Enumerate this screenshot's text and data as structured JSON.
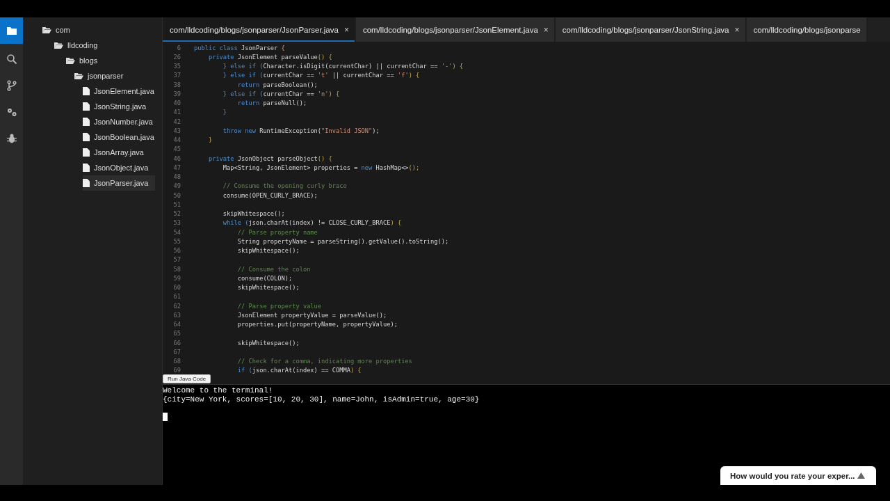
{
  "activity_bar": [
    {
      "kind": "files",
      "selected": true
    },
    {
      "kind": "search",
      "selected": false
    },
    {
      "kind": "branch",
      "selected": false
    },
    {
      "kind": "gears",
      "selected": false
    },
    {
      "kind": "bug",
      "selected": false
    }
  ],
  "tree": [
    {
      "label": "com",
      "kind": "folder",
      "children": [
        {
          "label": "lldcoding",
          "kind": "folder",
          "children": [
            {
              "label": "blogs",
              "kind": "folder",
              "children": [
                {
                  "label": "jsonparser",
                  "kind": "folder",
                  "children": [
                    {
                      "label": "JsonElement.java",
                      "kind": "file",
                      "selected": false
                    },
                    {
                      "label": "JsonString.java",
                      "kind": "file",
                      "selected": false
                    },
                    {
                      "label": "JsonNumber.java",
                      "kind": "file",
                      "selected": false
                    },
                    {
                      "label": "JsonBoolean.java",
                      "kind": "file",
                      "selected": false
                    },
                    {
                      "label": "JsonArray.java",
                      "kind": "file",
                      "selected": false
                    },
                    {
                      "label": "JsonObject.java",
                      "kind": "file",
                      "selected": false
                    },
                    {
                      "label": "JsonParser.java",
                      "kind": "file",
                      "selected": true
                    }
                  ]
                }
              ]
            }
          ]
        }
      ]
    }
  ],
  "tabs": [
    {
      "label": "com/lldcoding/blogs/jsonparser/JsonParser.java",
      "close": "×",
      "selected": true
    },
    {
      "label": "com/lldcoding/blogs/jsonparser/JsonElement.java",
      "close": "×",
      "selected": false
    },
    {
      "label": "com/lldcoding/blogs/jsonparser/JsonString.java",
      "close": "×",
      "selected": false
    },
    {
      "label": "com/lldcoding/blogs/jsonparse",
      "selected": false
    }
  ],
  "code_lines": [
    {
      "number": "6",
      "segments": [
        {
          "text": "public class ",
          "kind": "keyword"
        },
        {
          "text": "JsonParser ",
          "kind": "plain"
        },
        {
          "text": "{",
          "kind": "punct"
        }
      ]
    },
    {
      "number": "26",
      "segments": [
        {
          "text": "    private ",
          "kind": "keyword"
        },
        {
          "text": "JsonElement parseValue",
          "kind": "plain"
        },
        {
          "text": "() {",
          "kind": "punct"
        }
      ]
    },
    {
      "number": "35",
      "segments": [
        {
          "text": "        } else if (",
          "kind": "keyword"
        },
        {
          "text": "Character.isDigit(currentChar) || currentChar == ",
          "kind": "plain"
        },
        {
          "text": "'-'",
          "kind": "string"
        },
        {
          "text": ") {",
          "kind": "punct"
        }
      ]
    },
    {
      "number": "37",
      "segments": [
        {
          "text": "        } else if (",
          "kind": "keyword"
        },
        {
          "text": "currentChar == ",
          "kind": "plain"
        },
        {
          "text": "'t'",
          "kind": "string"
        },
        {
          "text": " || currentChar == ",
          "kind": "plain"
        },
        {
          "text": "'f'",
          "kind": "string"
        },
        {
          "text": ") {",
          "kind": "punct"
        }
      ]
    },
    {
      "number": "38",
      "segments": [
        {
          "text": "            return ",
          "kind": "keyword"
        },
        {
          "text": "parseBoolean();",
          "kind": "plain"
        }
      ]
    },
    {
      "number": "39",
      "segments": [
        {
          "text": "        } else if (",
          "kind": "keyword"
        },
        {
          "text": "currentChar == ",
          "kind": "plain"
        },
        {
          "text": "'n'",
          "kind": "string"
        },
        {
          "text": ") {",
          "kind": "punct"
        }
      ]
    },
    {
      "number": "40",
      "segments": [
        {
          "text": "            return ",
          "kind": "keyword"
        },
        {
          "text": "parseNull();",
          "kind": "plain"
        }
      ]
    },
    {
      "number": "41",
      "segments": [
        {
          "text": "        }",
          "kind": "keyword"
        }
      ]
    },
    {
      "number": "42"
    },
    {
      "number": "43",
      "segments": [
        {
          "text": "        throw new ",
          "kind": "keyword"
        },
        {
          "text": "RuntimeException(",
          "kind": "plain"
        },
        {
          "text": "\"Invalid JSON\"",
          "kind": "string"
        },
        {
          "text": ");",
          "kind": "plain"
        }
      ]
    },
    {
      "number": "44",
      "segments": [
        {
          "text": "    }",
          "kind": "punct"
        }
      ]
    },
    {
      "number": "45"
    },
    {
      "number": "46",
      "segments": [
        {
          "text": "    private ",
          "kind": "keyword"
        },
        {
          "text": "JsonObject parseObject",
          "kind": "plain"
        },
        {
          "text": "() {",
          "kind": "punct"
        }
      ]
    },
    {
      "number": "47",
      "segments": [
        {
          "text": "        Map<String, JsonElement> properties = ",
          "kind": "plain"
        },
        {
          "text": "new ",
          "kind": "keyword"
        },
        {
          "text": "HashMap<>",
          "kind": "plain"
        },
        {
          "text": "();",
          "kind": "punct"
        }
      ]
    },
    {
      "number": "48"
    },
    {
      "number": "49",
      "segments": [
        {
          "text": "        // Consume the opening curly brace",
          "kind": "comment"
        }
      ]
    },
    {
      "number": "50",
      "segments": [
        {
          "text": "        consume(OPEN_CURLY_BRACE);",
          "kind": "plain"
        }
      ]
    },
    {
      "number": "51"
    },
    {
      "number": "52",
      "segments": [
        {
          "text": "        skipWhitespace();",
          "kind": "plain"
        }
      ]
    },
    {
      "number": "53",
      "segments": [
        {
          "text": "        while (",
          "kind": "keyword"
        },
        {
          "text": "json.charAt(index) != CLOSE_CURLY_BRACE",
          "kind": "plain"
        },
        {
          "text": ") {",
          "kind": "punct"
        }
      ]
    },
    {
      "number": "54",
      "segments": [
        {
          "text": "            // Parse property name",
          "kind": "comment"
        }
      ]
    },
    {
      "number": "55",
      "segments": [
        {
          "text": "            String propertyName = parseString().getValue().toString();",
          "kind": "plain"
        }
      ]
    },
    {
      "number": "56",
      "segments": [
        {
          "text": "            skipWhitespace();",
          "kind": "plain"
        }
      ]
    },
    {
      "number": "57"
    },
    {
      "number": "58",
      "segments": [
        {
          "text": "            // Consume the colon",
          "kind": "comment"
        }
      ]
    },
    {
      "number": "59",
      "segments": [
        {
          "text": "            consume(COLON);",
          "kind": "plain"
        }
      ]
    },
    {
      "number": "60",
      "segments": [
        {
          "text": "            skipWhitespace();",
          "kind": "plain"
        }
      ]
    },
    {
      "number": "61"
    },
    {
      "number": "62",
      "segments": [
        {
          "text": "            // Parse property value",
          "kind": "comment"
        }
      ]
    },
    {
      "number": "63",
      "segments": [
        {
          "text": "            JsonElement propertyValue = parseValue();",
          "kind": "plain"
        }
      ]
    },
    {
      "number": "64",
      "segments": [
        {
          "text": "            properties.put(propertyName, propertyValue);",
          "kind": "plain"
        }
      ]
    },
    {
      "number": "65"
    },
    {
      "number": "66",
      "segments": [
        {
          "text": "            skipWhitespace();",
          "kind": "plain"
        }
      ]
    },
    {
      "number": "67"
    },
    {
      "number": "68",
      "segments": [
        {
          "text": "            // Check for a comma, indicating more properties",
          "kind": "comment"
        }
      ]
    },
    {
      "number": "69",
      "segments": [
        {
          "text": "            if (",
          "kind": "keyword"
        },
        {
          "text": "json.charAt(index) == COMMA",
          "kind": "plain"
        },
        {
          "text": ") {",
          "kind": "punct"
        }
      ]
    }
  ],
  "run_button": "Run Java Code",
  "terminal": [
    "Welcome to the terminal!",
    "{city=New York, scores=[10, 20, 30], name=John, isAdmin=true, age=30}"
  ],
  "feedback": {
    "label": "How would you rate your exper...",
    "expanded": false
  }
}
